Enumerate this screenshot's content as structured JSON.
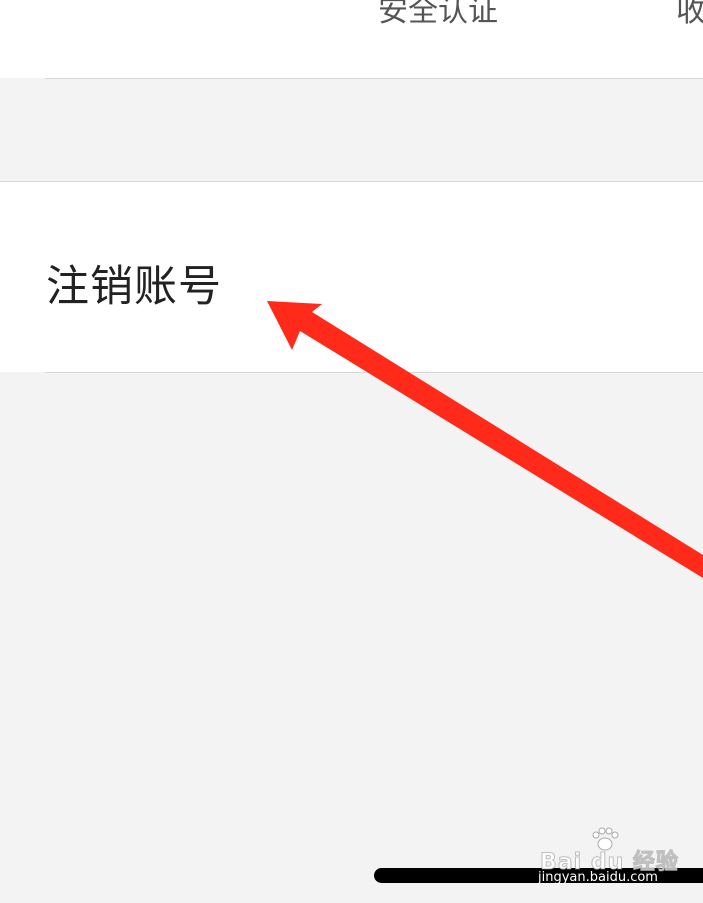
{
  "top_row": {
    "security_label": "安全认证",
    "truncated_label": "收"
  },
  "settings": {
    "cancel_account_label": "注销账号"
  },
  "annotation": {
    "arrow_color": "#ff2a1a"
  },
  "watermark": {
    "brand": "Bai du 经验",
    "url": "jingyan.baidu.com"
  }
}
